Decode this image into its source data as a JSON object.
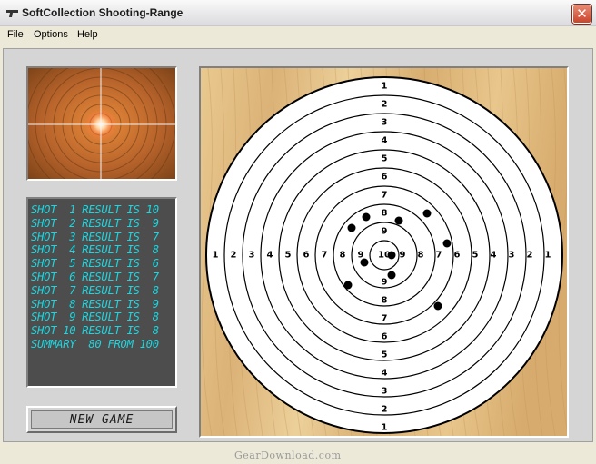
{
  "window": {
    "title": "SoftCollection Shooting-Range",
    "close_label": "✕"
  },
  "menu": {
    "items": [
      "File",
      "Options",
      "Help"
    ]
  },
  "results": {
    "lines": [
      "SHOT  1 RESULT IS 10",
      "SHOT  2 RESULT IS  9",
      "SHOT  3 RESULT IS  7",
      "SHOT  4 RESULT IS  8",
      "SHOT  5 RESULT IS  6",
      "SHOT  6 RESULT IS  7",
      "SHOT  7 RESULT IS  8",
      "SHOT  8 RESULT IS  9",
      "SHOT  9 RESULT IS  8",
      "SHOT 10 RESULT IS  8",
      "SUMMARY  80 FROM 100"
    ],
    "text_color": "#1dd6e0"
  },
  "buttons": {
    "new_game": "NEW GAME"
  },
  "target": {
    "vertical_labels_top": [
      "1",
      "2",
      "3",
      "4",
      "5",
      "6",
      "7",
      "8",
      "9"
    ],
    "vertical_labels_bottom": [
      "9",
      "8",
      "7",
      "6",
      "5",
      "4",
      "3",
      "2",
      "1"
    ],
    "horizontal_labels_left": [
      "1",
      "2",
      "3",
      "4",
      "5",
      "6",
      "7",
      "8",
      "9"
    ],
    "horizontal_labels_right": [
      "9",
      "8",
      "7",
      "6",
      "5",
      "4",
      "3",
      "2",
      "1"
    ],
    "center_label": "10",
    "shots": [
      {
        "id": 1,
        "score": 10
      },
      {
        "id": 2,
        "score": 9
      },
      {
        "id": 3,
        "score": 7
      },
      {
        "id": 4,
        "score": 8
      },
      {
        "id": 5,
        "score": 6
      },
      {
        "id": 6,
        "score": 7
      },
      {
        "id": 7,
        "score": 8
      },
      {
        "id": 8,
        "score": 9
      },
      {
        "id": 9,
        "score": 8
      },
      {
        "id": 10,
        "score": 8
      }
    ]
  },
  "watermark": "GearDownload.com"
}
